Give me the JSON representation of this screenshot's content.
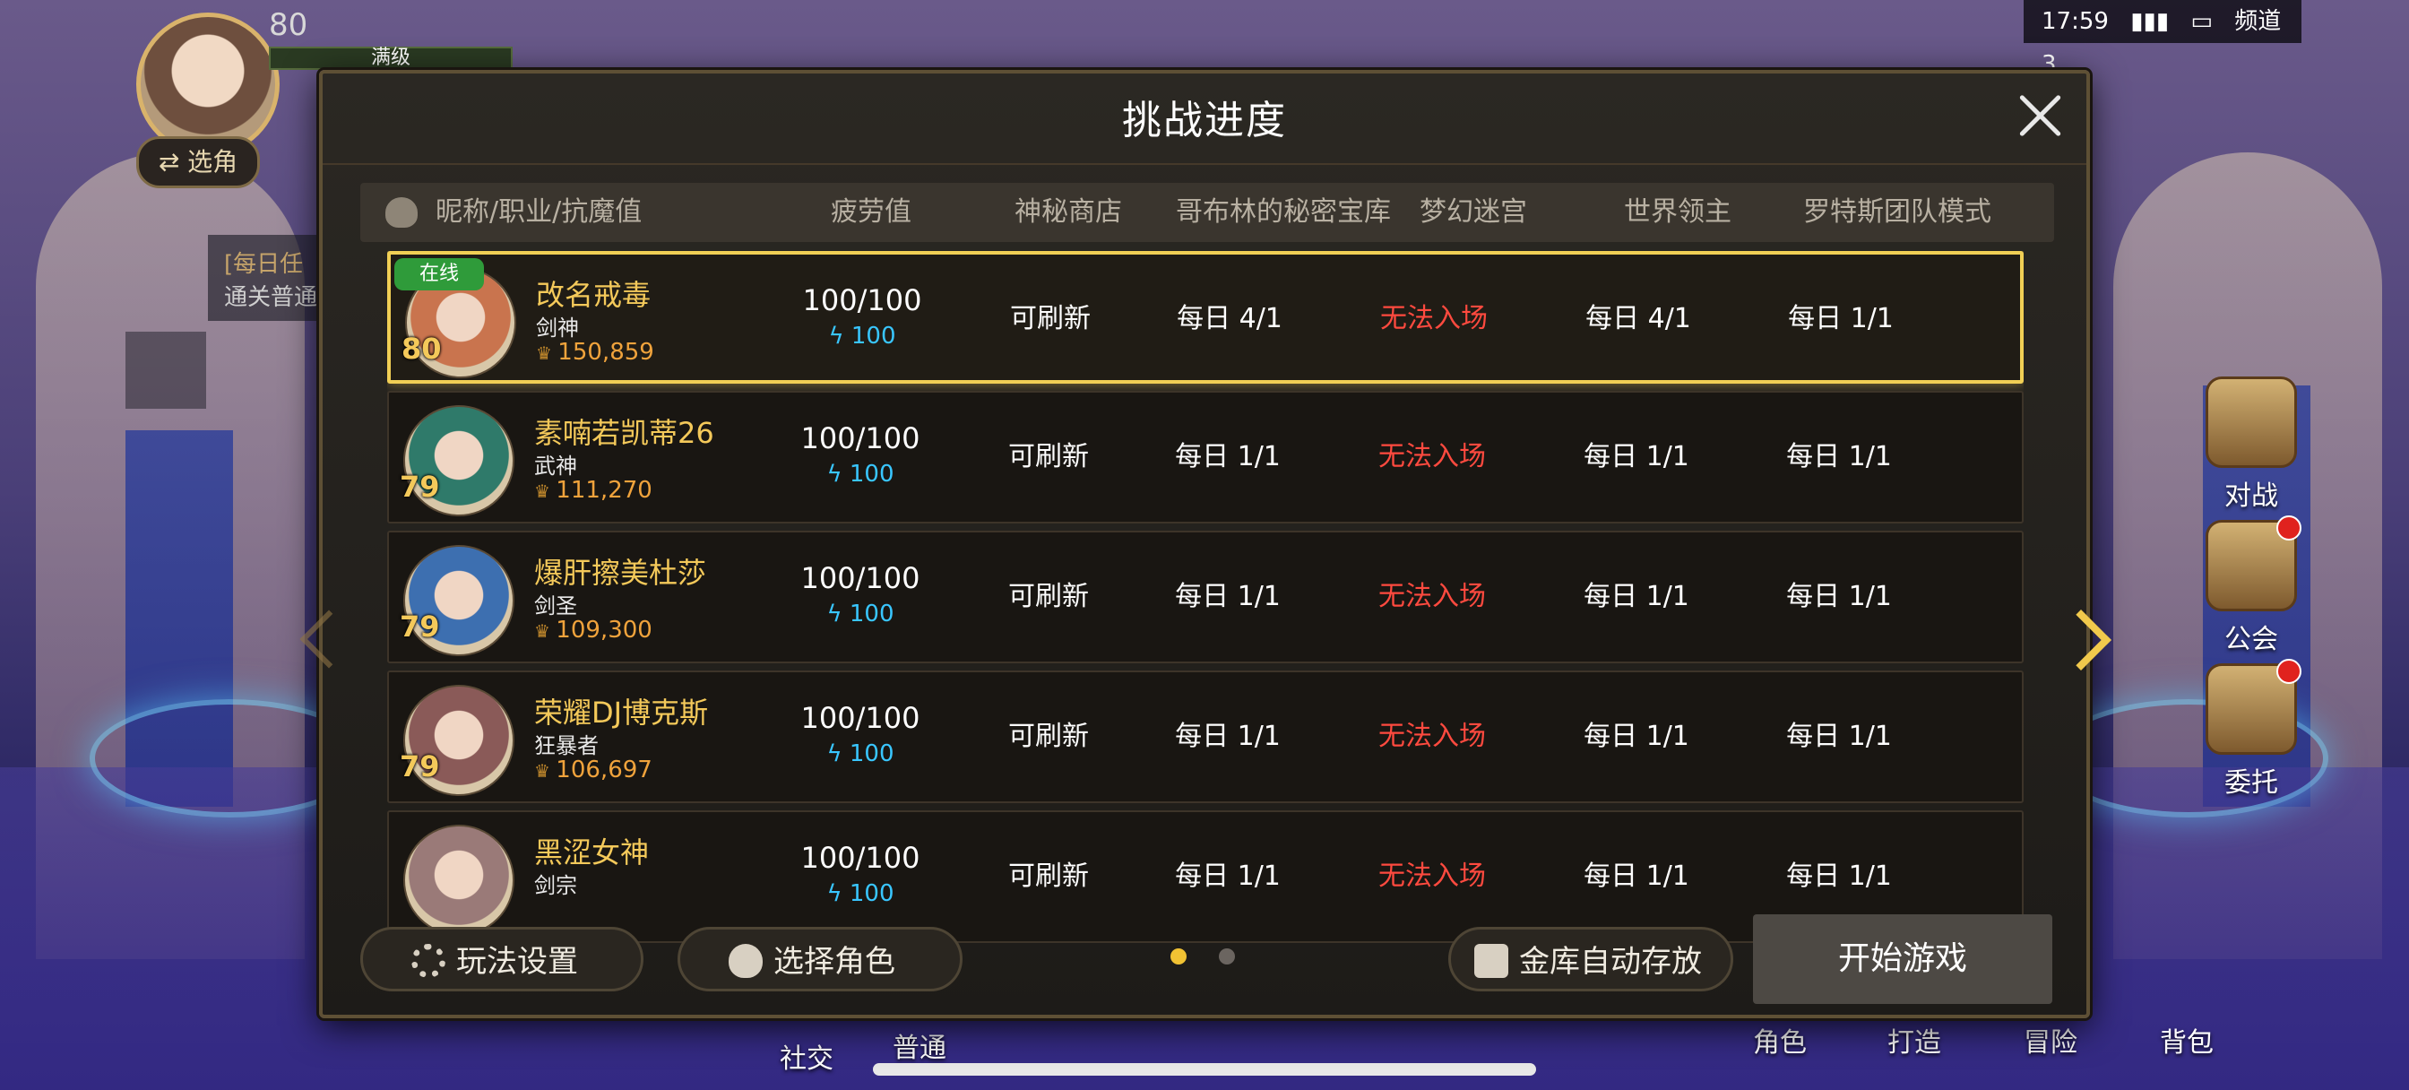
{
  "hud": {
    "level": "80",
    "bar_label": "满级",
    "switch_role": "⇄ 选角",
    "task_title": "[每日任",
    "task_desc": "通关普通",
    "status": {
      "time": "17:59",
      "signal": "▮▮▮",
      "battery": "▭",
      "channel": "频道3"
    },
    "side": [
      {
        "label": "对战"
      },
      {
        "label": "公会"
      },
      {
        "label": "委托"
      }
    ],
    "bottom": [
      "社交",
      "普通",
      "角色",
      "打造",
      "冒险",
      "背包"
    ]
  },
  "dialog": {
    "title": "挑战进度",
    "headers": {
      "name": "昵称/职业/抗魔值",
      "fatigue": "疲劳值",
      "shop": "神秘商店",
      "goblin": "哥布林的秘密宝库",
      "maze": "梦幻迷宫",
      "boss": "世界领主",
      "raid": "罗特斯团队模式"
    },
    "rows": [
      {
        "online": "在线",
        "level": "80",
        "name": "改名戒毒",
        "job": "剑神",
        "power": "150,859",
        "fatigue": "100/100",
        "energy": "100",
        "shop": "可刷新",
        "goblin": "每日 4/1",
        "maze": "无法入场",
        "boss": "每日 4/1",
        "raid": "每日 1/1",
        "avatar_color": "#c9744e"
      },
      {
        "online": "",
        "level": "79",
        "name": "素喃若凯蒂26",
        "job": "武神",
        "power": "111,270",
        "fatigue": "100/100",
        "energy": "100",
        "shop": "可刷新",
        "goblin": "每日 1/1",
        "maze": "无法入场",
        "boss": "每日 1/1",
        "raid": "每日 1/1",
        "avatar_color": "#2f7a6a"
      },
      {
        "online": "",
        "level": "79",
        "name": "爆肝擦美杜莎",
        "job": "剑圣",
        "power": "109,300",
        "fatigue": "100/100",
        "energy": "100",
        "shop": "可刷新",
        "goblin": "每日 1/1",
        "maze": "无法入场",
        "boss": "每日 1/1",
        "raid": "每日 1/1",
        "avatar_color": "#3d6fb0"
      },
      {
        "online": "",
        "level": "79",
        "name": "荣耀DJ博克斯",
        "job": "狂暴者",
        "power": "106,697",
        "fatigue": "100/100",
        "energy": "100",
        "shop": "可刷新",
        "goblin": "每日 1/1",
        "maze": "无法入场",
        "boss": "每日 1/1",
        "raid": "每日 1/1",
        "avatar_color": "#8a5a58"
      },
      {
        "online": "",
        "level": "",
        "name": "黑涩女神",
        "job": "剑宗",
        "power": "",
        "fatigue": "100/100",
        "energy": "100",
        "shop": "可刷新",
        "goblin": "每日 1/1",
        "maze": "无法入场",
        "boss": "每日 1/1",
        "raid": "每日 1/1",
        "avatar_color": "#9a7a78"
      }
    ],
    "footer": {
      "settings": "玩法设置",
      "select_role": "选择角色",
      "auto_store": "金库自动存放",
      "start": "开始游戏"
    },
    "pages": {
      "current": 1,
      "total": 2
    }
  },
  "colors": {
    "gold": "#f4c95a",
    "red": "#ff4a3f",
    "cyan": "#39c6ff",
    "online": "#2f9b3a"
  }
}
